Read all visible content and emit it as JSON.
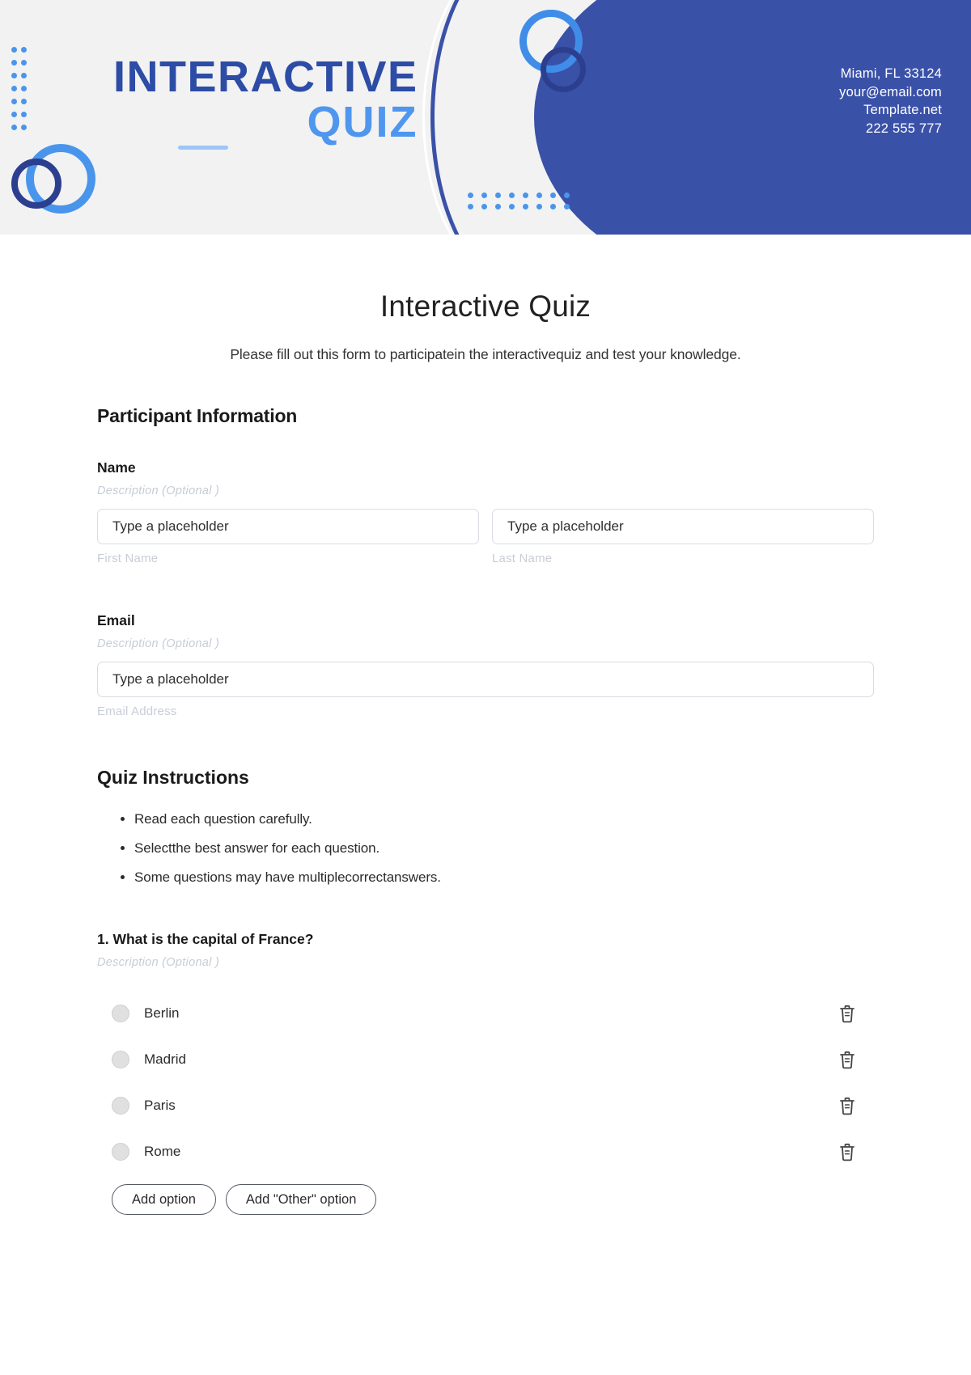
{
  "header": {
    "logo_line1": "INTERACTIVE",
    "logo_line2": "QUIZ",
    "contact": {
      "address": "Miami, FL 33124",
      "email": "your@email.com",
      "website": "Template.net",
      "phone": "222 555 777"
    },
    "colors": {
      "dark_blue": "#3a51a8",
      "light_blue": "#4f96ef",
      "header_bg": "#f2f2f2"
    }
  },
  "document": {
    "title": "Interactive Quiz",
    "subtitle": "Please fill out this form to participatein the interactivequiz and test your knowledge."
  },
  "participant_section": {
    "title": "Participant Information",
    "name_field": {
      "label": "Name",
      "description": "Description  (Optional )",
      "first": {
        "placeholder": "Type a placeholder",
        "sub_label": "First Name"
      },
      "last": {
        "placeholder": "Type a placeholder",
        "sub_label": "Last Name"
      }
    },
    "email_field": {
      "label": "Email",
      "description": "Description  (Optional )",
      "placeholder": "Type a placeholder",
      "sub_label": "Email Address"
    }
  },
  "instructions_section": {
    "title": "Quiz Instructions",
    "items": [
      "Read each question carefully.",
      "Selectthe best answer for each question.",
      "Some questions may have multiplecorrectanswers."
    ]
  },
  "question1": {
    "title": "1. What is the capital of France?",
    "description": "Description  (Optional )",
    "options": [
      {
        "label": "Berlin",
        "delete_icon": "trash-icon"
      },
      {
        "label": "Madrid",
        "delete_icon": "trash-icon"
      },
      {
        "label": "Paris",
        "delete_icon": "trash-icon"
      },
      {
        "label": "Rome",
        "delete_icon": "trash-icon"
      }
    ],
    "add_option_label": "Add option",
    "add_other_option_label": "Add \"Other\" option"
  }
}
